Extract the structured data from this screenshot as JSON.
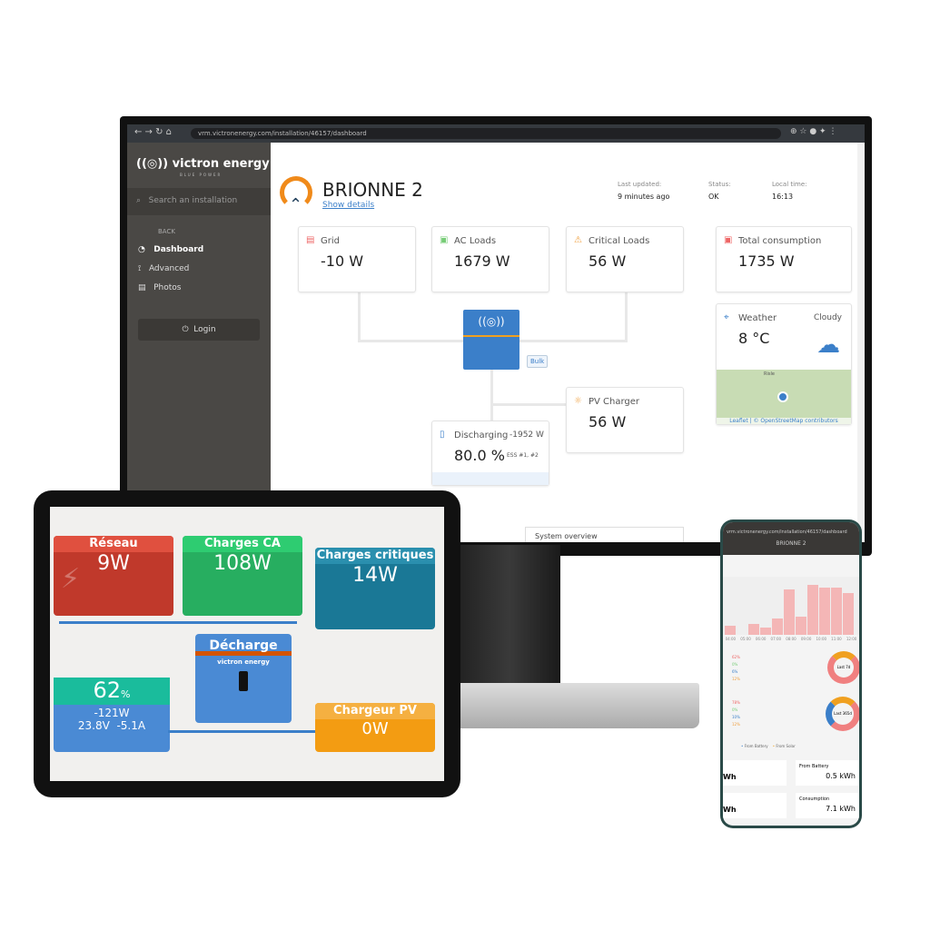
{
  "browser": {
    "url": "vrm.victronenergy.com/installation/46157/dashboard"
  },
  "sidebar": {
    "brand": "victron energy",
    "brand_sub": "BLUE POWER",
    "search_placeholder": "Search an installation",
    "back": "BACK",
    "items": [
      {
        "label": "Dashboard",
        "icon": "gauge-icon"
      },
      {
        "label": "Advanced",
        "icon": "chart-icon"
      },
      {
        "label": "Photos",
        "icon": "photo-icon"
      }
    ],
    "login": "Login"
  },
  "header": {
    "title": "BRIONNE 2",
    "show_details": "Show details",
    "last_updated_label": "Last updated:",
    "last_updated": "9 minutes ago",
    "status_label": "Status:",
    "status": "OK",
    "local_time_label": "Local time:",
    "local_time": "16:13"
  },
  "cards": {
    "grid": {
      "label": "Grid",
      "value": "-10 W"
    },
    "ac_loads": {
      "label": "AC Loads",
      "value": "1679 W"
    },
    "critical_loads": {
      "label": "Critical Loads",
      "value": "56 W"
    },
    "total": {
      "label": "Total consumption",
      "value": "1735 W"
    },
    "pv": {
      "label": "PV Charger",
      "value": "56 W"
    },
    "battery": {
      "label": "Discharging",
      "power": "-1952 W",
      "soc": "80.0 %",
      "ess": "ESS #1, #2"
    },
    "inverter_state": "Bulk"
  },
  "weather": {
    "label": "Weather",
    "condition": "Cloudy",
    "temp": "8 °C",
    "map_place": "Risle",
    "map_attr": "Leaflet | © OpenStreetMap contributors"
  },
  "bottom": {
    "select": "System overview"
  },
  "tablet": {
    "grid": {
      "label": "Réseau",
      "value": "9W"
    },
    "ac": {
      "label": "Charges CA",
      "value": "108W"
    },
    "critical": {
      "label": "Charges critiques",
      "value": "14W"
    },
    "inverter": {
      "label": "Décharge",
      "brand": "victron energy"
    },
    "battery": {
      "soc": "62",
      "unit": "%",
      "power": "-121W",
      "voltage": "23.8V",
      "current": "-5.1A"
    },
    "pv": {
      "label": "Chargeur PV",
      "value": "0W"
    }
  },
  "phone": {
    "url": "vrm.victronenergy.com/installation/46157/dashboard",
    "title": "BRIONNE 2",
    "hours": [
      "04:00",
      "05:00",
      "06:00",
      "07:00",
      "08:00",
      "09:00",
      "10:00",
      "11:00",
      "12:00"
    ],
    "donut1": {
      "label": "Last 7d",
      "rows": [
        "62%",
        "0%",
        "6%",
        "12%"
      ]
    },
    "donut2": {
      "label": "Last 365d",
      "rows": [
        "78%",
        "0%",
        "10%",
        "12%"
      ]
    },
    "legend": [
      "From Battery",
      "From Solar"
    ],
    "tiles": [
      {
        "label": "From Battery",
        "value": "0.5 kWh"
      },
      {
        "label": "Consumption",
        "value": "7.1 kWh"
      }
    ]
  },
  "colors": {
    "victron_blue": "#3b7fc9",
    "grid_red": "#e05545",
    "ac_green": "#2fbf6a",
    "critical_teal": "#1e7f99",
    "pv_orange": "#f0a020"
  }
}
